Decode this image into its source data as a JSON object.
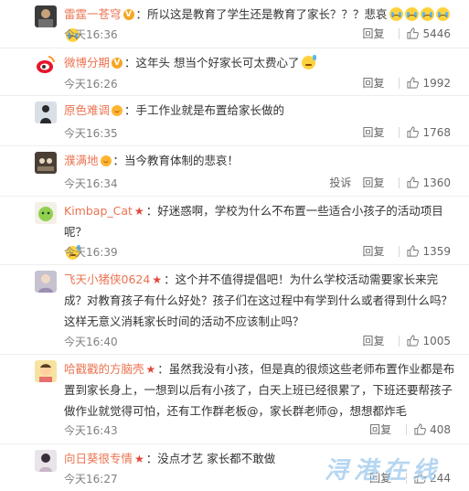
{
  "ui": {
    "reply_label": "回复",
    "report_label": "投诉"
  },
  "comments": [
    {
      "username": "雷霆一苍穹",
      "badge": "v",
      "text": "所以这是教育了学生还是教育了家长？？？悲哀",
      "emoji": [
        "cry",
        "cry",
        "cry",
        "cry",
        "cry"
      ],
      "time": "今天16:36",
      "likes": "5446"
    },
    {
      "username": "微博分期",
      "badge": "v",
      "text": "这年头 想当个好家长可太费心了",
      "emoji": [
        "sweat"
      ],
      "time": "今天16:26",
      "likes": "1992"
    },
    {
      "username": "原色难调",
      "badge": "face",
      "text": "手工作业就是布置给家长做的",
      "emoji": [],
      "time": "今天16:35",
      "likes": "1768"
    },
    {
      "username": "濮满地",
      "badge": "face",
      "text": "当今教育体制的悲哀！",
      "emoji": [],
      "time": "今天16:34",
      "likes": "1360"
    },
    {
      "username": "Kimbap_Cat",
      "badge": "star",
      "text": "好迷惑啊，学校为什么不布置一些适合小孩子的活动项目呢？",
      "emoji": [
        "sweat"
      ],
      "time": "今天16:39",
      "likes": "1359"
    },
    {
      "username": "飞天小猪侠0624",
      "badge": "star",
      "text": "这个并不值得提倡吧！为什么学校活动需要家长来完成？对教育孩子有什么好处？孩子们在这过程中有学到什么或者得到什么吗？这样无意义消耗家长时间的活动不应该制止吗？",
      "emoji": [],
      "time": "今天16:40",
      "likes": "1005"
    },
    {
      "username": "哈戳戳的方脑壳",
      "badge": "star",
      "text": "虽然我没有小孩，但是真的很烦这些老师布置作业都是布置到家长身上，一想到以后有小孩了，白天上班已经很累了，下班还要帮孩子做作业就觉得可怕，还有工作群老板@，家长群老师@，想想都炸毛",
      "emoji": [],
      "time": "今天16:43",
      "likes": "408"
    },
    {
      "username": "向日葵很专情",
      "badge": "star",
      "text": "没点才艺 家长都不敢做",
      "emoji": [],
      "time": "今天16:27",
      "likes": "244"
    }
  ],
  "colors": {
    "username": "#eb7350",
    "text": "#333333",
    "time": "#808080",
    "separator": "#eeeeee"
  },
  "watermark": "浔港在线"
}
